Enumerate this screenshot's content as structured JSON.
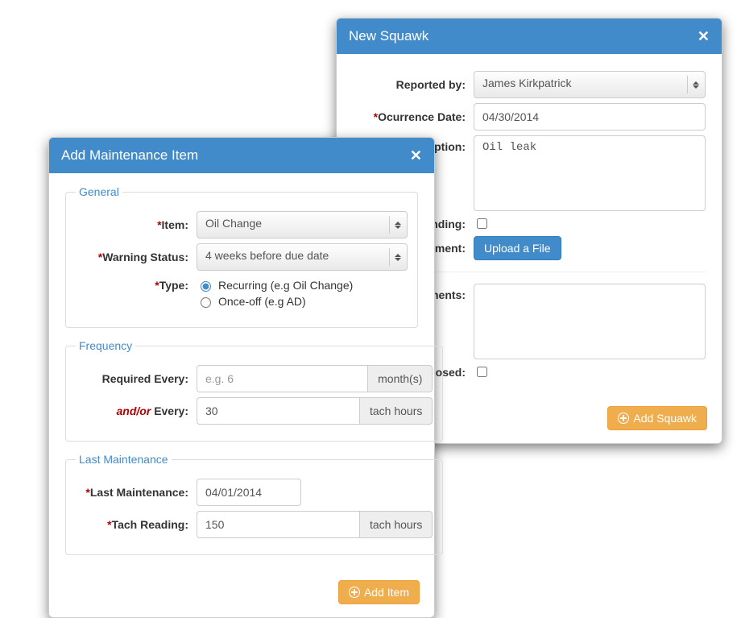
{
  "squawk": {
    "title": "New Squawk",
    "labels": {
      "reported_by": "Reported by:",
      "occurrence_date": "Ocurrence Date:",
      "description": "iption:",
      "grounding": "nding:",
      "attachment": "ment:",
      "comments": "nents:",
      "closed": "losed:"
    },
    "values": {
      "reported_by": "James Kirkpatrick",
      "occurrence_date": "04/30/2014",
      "description": "Oil leak",
      "grounding_checked": false,
      "closed_checked": false
    },
    "buttons": {
      "upload": "Upload a File",
      "add": "Add Squawk"
    }
  },
  "maint": {
    "title": "Add Maintenance Item",
    "legends": {
      "general": "General",
      "frequency": "Frequency",
      "last": "Last Maintenance"
    },
    "labels": {
      "item": "Item:",
      "warning_status": "Warning Status:",
      "type": "Type:",
      "required_every": "Required Every:",
      "andor_every": "Every:",
      "last_maintenance": "Last Maintenance:",
      "tach_reading": "Tach Reading:"
    },
    "andor_prefix": "and/or",
    "values": {
      "item": "Oil Change",
      "warning_status": "4 weeks before due date",
      "type_recurring_label": "Recurring (e.g Oil Change)",
      "type_onceoff_label": "Once-off (e.g AD)",
      "type_selected": "recurring",
      "required_every_placeholder": "e.g. 6",
      "required_every_value": "",
      "required_every_unit": "month(s)",
      "tach_every_value": "30",
      "tach_every_unit": "tach hours",
      "last_maintenance": "04/01/2014",
      "tach_reading": "150",
      "tach_reading_unit": "tach hours"
    },
    "buttons": {
      "add": "Add Item"
    }
  }
}
